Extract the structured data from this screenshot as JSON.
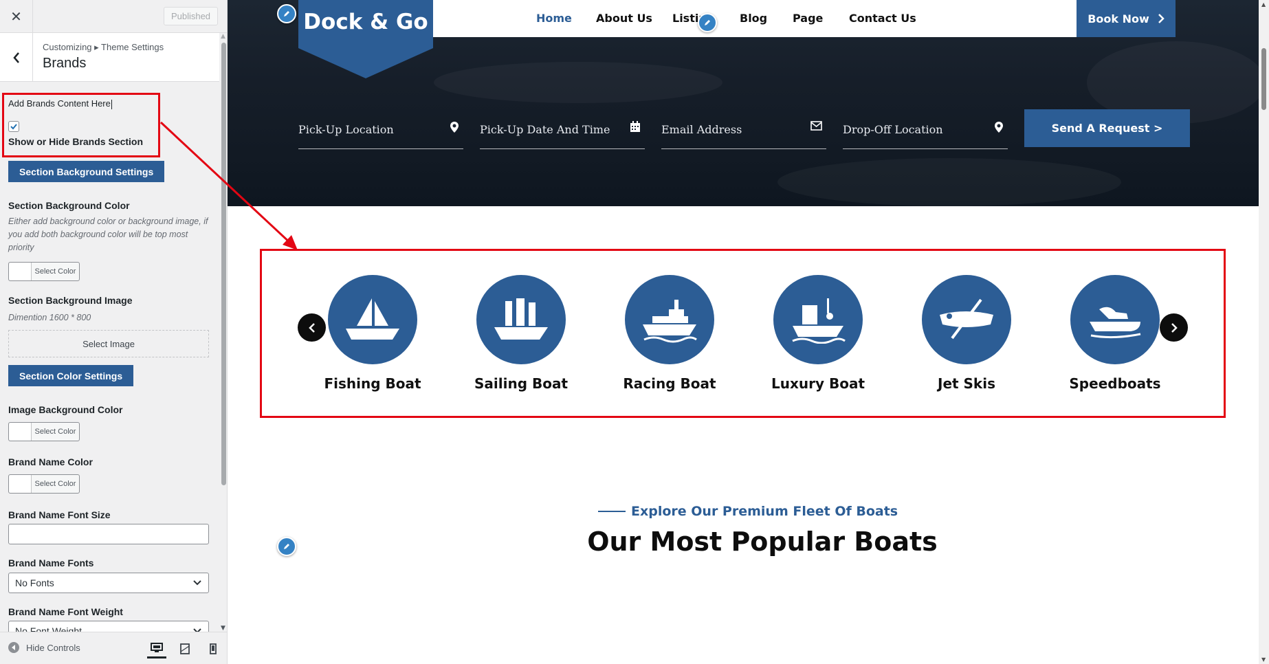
{
  "sidebar": {
    "published_label": "Published",
    "breadcrumb": "Customizing ▸ Theme Settings",
    "section_title": "Brands",
    "brands_content_label": "Add Brands Content Here",
    "show_hide_label": "Show or Hide Brands Section",
    "show_hide_checked": true,
    "bg_settings_button": "Section Background Settings",
    "bg_color_label": "Section Background Color",
    "bg_color_desc": "Either add background color or background image, if you add both background color will be top most priority",
    "select_color": "Select Color",
    "bg_image_label": "Section Background Image",
    "bg_image_desc": "Dimention 1600 * 800",
    "select_image": "Select Image",
    "color_settings_button": "Section Color Settings",
    "image_bg_color_label": "Image Background Color",
    "brand_name_color_label": "Brand Name Color",
    "brand_name_font_size_label": "Brand Name Font Size",
    "brand_name_fonts_label": "Brand Name Fonts",
    "brand_name_fonts_value": "No Fonts",
    "brand_name_font_weight_label": "Brand Name Font Weight",
    "brand_name_font_weight_value": "No Font Weight",
    "hide_controls": "Hide Controls"
  },
  "site": {
    "logo": "Dock & Go",
    "nav": [
      {
        "label": "Home",
        "active": true
      },
      {
        "label": "About Us"
      },
      {
        "label": "Listin"
      },
      {
        "label": "Blog"
      },
      {
        "label": "Page"
      },
      {
        "label": "Contact Us"
      }
    ],
    "book_now": "Book Now",
    "search_fields": [
      "Pick-Up Location",
      "Pick-Up Date And Time",
      "Email Address",
      "Drop-Off Location"
    ],
    "send_request": "Send A Request >",
    "brands": [
      "Fishing Boat",
      "Sailing Boat",
      "Racing Boat",
      "Luxury Boat",
      "Jet Skis",
      "Speedboats"
    ],
    "section_subtitle": "Explore Our Premium Fleet Of Boats",
    "section_title": "Our Most Popular Boats"
  },
  "colors": {
    "brand_blue": "#2c5d95",
    "annotation_red": "#e30613",
    "edit_pencil": "#3582c4"
  }
}
